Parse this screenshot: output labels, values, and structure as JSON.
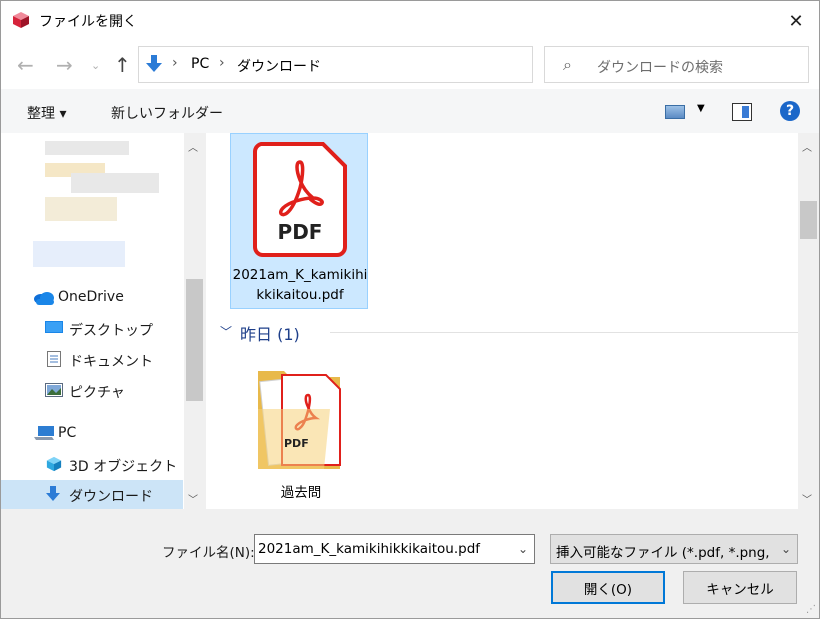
{
  "window": {
    "title": "ファイルを開く"
  },
  "nav": {
    "address": [
      "PC",
      "ダウンロード"
    ],
    "search_placeholder": "ダウンロードの検索"
  },
  "toolbar": {
    "organize": "整理 ▾",
    "new_folder": "新しいフォルダー",
    "help": "?"
  },
  "sidebar": {
    "items": [
      {
        "label": "OneDrive"
      },
      {
        "label": "デスクトップ"
      },
      {
        "label": "ドキュメント"
      },
      {
        "label": "ピクチャ"
      },
      {
        "label": "PC"
      },
      {
        "label": "3D オブジェクト"
      },
      {
        "label": "ダウンロード"
      }
    ]
  },
  "files": {
    "selected_file": {
      "name": "2021am_K_kamikihikkikaitou.pdf",
      "icon_text": "PDF"
    },
    "group_label": "昨日 (1)",
    "folder": {
      "name": "過去問",
      "icon_text": "PDF"
    }
  },
  "bottom": {
    "filename_label": "ファイル名(N):",
    "filename_value": "2021am_K_kamikihikkikaitou.pdf",
    "filetype_value": "挿入可能なファイル (*.pdf, *.png,",
    "open_label": "開く(O)",
    "cancel_label": "キャンセル"
  },
  "colors": {
    "accent": "#0078d7",
    "selection": "#cce8ff",
    "pdf_red": "#e0201b",
    "group_text": "#1e3f8a"
  }
}
